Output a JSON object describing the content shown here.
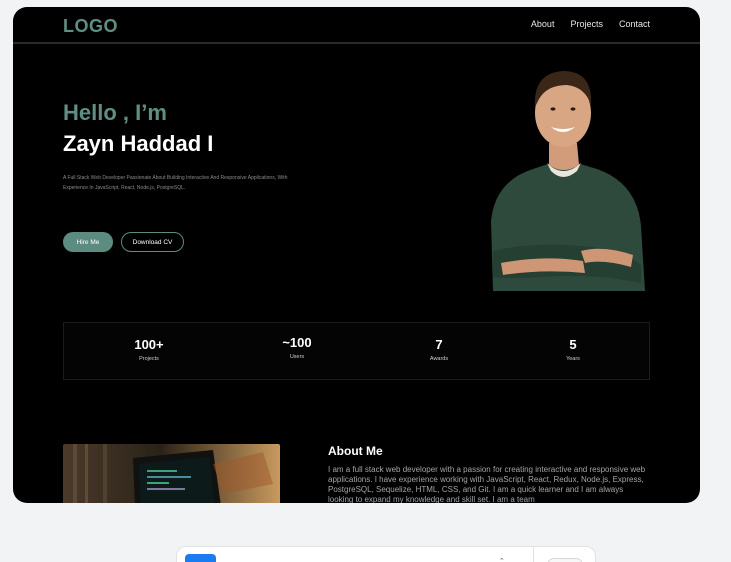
{
  "nav": {
    "logo": "LOGO",
    "links": [
      "About",
      "Projects",
      "Contact"
    ]
  },
  "hero": {
    "greeting": "Hello , I’m",
    "name": "Zayn Haddad I",
    "bio": "A Full Stack Web Developer Passionate About Building Interactive And Responsive Applications, With Experience In JavaScript, React, Node.js, PostgreSQL.",
    "hire_label": "Hire Me",
    "cv_label": "Download CV"
  },
  "stats": [
    {
      "value": "100+",
      "label": "Projects"
    },
    {
      "value": "~100",
      "label": "Users"
    },
    {
      "value": "7",
      "label": "Awards"
    },
    {
      "value": "5",
      "label": "Years"
    }
  ],
  "about": {
    "title": "About Me",
    "text": "I am a full stack web developer with a passion for creating interactive and responsive web applications. I have experience working with JavaScript, React, Redux, Node.js, Express, PostgreSQL, Sequelize, HTML, CSS, and Git. I am a quick learner and I am always looking to expand my knowledge and skill set. I am a team"
  },
  "colors": {
    "accent": "#5f8f84",
    "background": "#000000",
    "page": "#f2f3f5",
    "sweater": "#2e4a3c"
  }
}
